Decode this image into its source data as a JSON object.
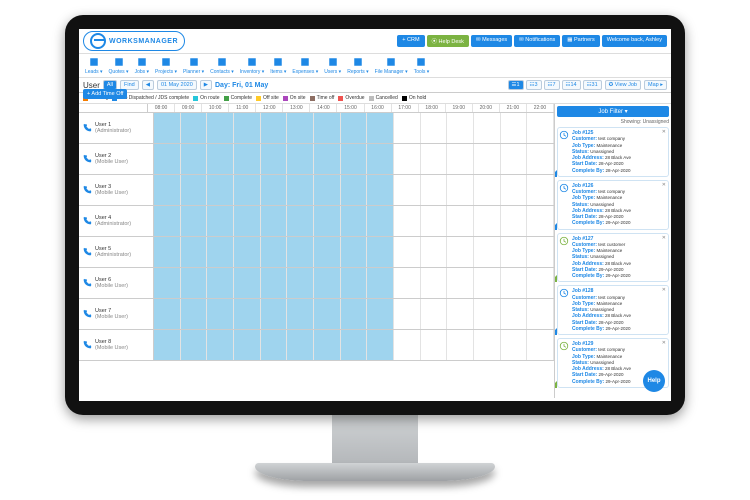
{
  "brand": {
    "name": "WORKSMANAGER"
  },
  "topButtons": [
    {
      "label": "+ CRM",
      "cls": ""
    },
    {
      "label": "⦿ Help Desk",
      "cls": "green"
    },
    {
      "label": "✉ Messages",
      "cls": ""
    },
    {
      "label": "✉ Notifications",
      "cls": ""
    },
    {
      "label": "▦ Partners",
      "cls": ""
    },
    {
      "label": "Welcome back, Ashley",
      "cls": ""
    }
  ],
  "menu": [
    "Leads",
    "Quotes",
    "Jobs",
    "Projects",
    "Planner",
    "Contacts",
    "Inventory",
    "Items",
    "Expenses",
    "Users",
    "Reports",
    "File Manager",
    "Tools"
  ],
  "toolbar": {
    "userLabel": "User",
    "allBtn": "All",
    "findBtn": "Find",
    "dateBack": "◀",
    "date": "01 May 2020",
    "dateFwd": "▶",
    "dayLabel": "Day: Fri, 01 May",
    "addTimeOff": "+ Add Time Off",
    "views": [
      "☰1",
      "☷3",
      "☷7",
      "☷14",
      "☷31"
    ],
    "viewJob": "✪ View Job",
    "mapLink": "Map ▸"
  },
  "legend": [
    {
      "c": "#f57c00",
      "t": "Pending"
    },
    {
      "c": "#1e88e5",
      "t": "Job Dispatched / JDS complete"
    },
    {
      "c": "#26c6da",
      "t": "On route"
    },
    {
      "c": "#43a047",
      "t": "Complete"
    },
    {
      "c": "#ffca28",
      "t": "Off site"
    },
    {
      "c": "#ab47bc",
      "t": "On site"
    },
    {
      "c": "#8d6e63",
      "t": "Time off"
    },
    {
      "c": "#ef5350",
      "t": "Overdue"
    },
    {
      "c": "#bdbdbd",
      "t": "Cancelled"
    },
    {
      "c": "#000000",
      "t": "On hold"
    }
  ],
  "hours": [
    "08:00",
    "09:00",
    "10:00",
    "11:00",
    "12:00",
    "13:00",
    "14:00",
    "15:00",
    "16:00",
    "17:00",
    "18:00",
    "19:00",
    "20:00",
    "21:00",
    "22:00"
  ],
  "users": [
    {
      "name": "User 1",
      "role": "(Administrator)"
    },
    {
      "name": "User 2",
      "role": "(Mobile User)"
    },
    {
      "name": "User 3",
      "role": "(Mobile User)"
    },
    {
      "name": "User 4",
      "role": "(Administrator)"
    },
    {
      "name": "User 5",
      "role": "(Administrator)"
    },
    {
      "name": "User 6",
      "role": "(Mobile User)"
    },
    {
      "name": "User 7",
      "role": "(Mobile User)"
    },
    {
      "name": "User 8",
      "role": "(Mobile User)"
    }
  ],
  "side": {
    "header": "Job Filter ▾",
    "showing": "Showing: Unassigned"
  },
  "jobs": [
    {
      "ref": "Job #125",
      "ok": false,
      "customer": "test company",
      "type": "Maintenance",
      "status": "Unassigned",
      "addr": "28 Black Ave",
      "start": "28-Apr-2020",
      "complete": "28-Apr-2020"
    },
    {
      "ref": "Job #126",
      "ok": false,
      "customer": "test company",
      "type": "Maintenance",
      "status": "Unassigned",
      "addr": "28 Black Ave",
      "start": "28-Apr-2020",
      "complete": "29-Apr-2020"
    },
    {
      "ref": "Job #127",
      "ok": true,
      "customer": "test customer",
      "type": "Maintenance",
      "status": "Unassigned",
      "addr": "28 Black Ave",
      "start": "29-Apr-2020",
      "complete": "29-Apr-2020"
    },
    {
      "ref": "Job #128",
      "ok": false,
      "customer": "test company",
      "type": "Maintenance",
      "status": "Unassigned",
      "addr": "28 Black Ave",
      "start": "28-Apr-2020",
      "complete": "29-Apr-2020"
    },
    {
      "ref": "Job #129",
      "ok": true,
      "customer": "test company",
      "type": "Maintenance",
      "status": "Unassigned",
      "addr": "28 Black Ave",
      "start": "29-Apr-2020",
      "complete": "29-Apr-2020"
    }
  ],
  "labels": {
    "customer": "Customer:",
    "jobType": "Job Type:",
    "status": "Status:",
    "addr": "Job Address:",
    "start": "Start Date:",
    "complete": "Complete By:"
  },
  "help": "Help"
}
